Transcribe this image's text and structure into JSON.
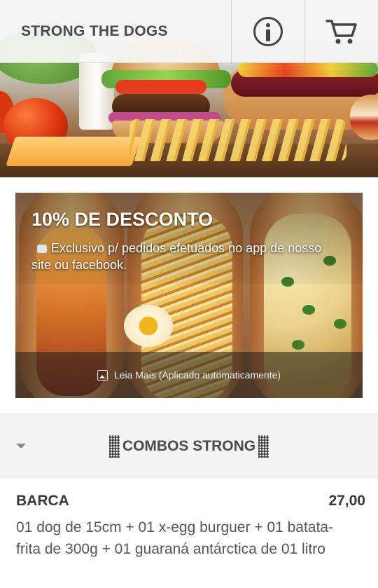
{
  "header": {
    "title": "STRONG THE DOGS",
    "info_icon": "info-icon",
    "cart_icon": "cart-icon"
  },
  "promo": {
    "heading": "10% DE DESCONTO",
    "description": "Exclusivo p/ pedidos efetuados no app de nosso site ou facebook.",
    "pin_icon": "pushpin-icon",
    "read_more_icon": "image-icon",
    "read_more_label": "Leia Mais (Aplicado automaticamente)"
  },
  "category": {
    "toggle_icon": "caret-down-icon",
    "title": "COMBOS STRONG"
  },
  "products": [
    {
      "name": "BARCA",
      "price": "27,00",
      "description": "01 dog de 15cm + 01 x-egg burguer + 01 batata-frita de 300g + 01 guaraná antárctica de 01 litro"
    }
  ],
  "colors": {
    "header_bg": "#f6f6f6",
    "header_text": "#4a4a4a",
    "category_bg": "#f4f4f4",
    "overlay_bar": "#1e1e1e"
  }
}
